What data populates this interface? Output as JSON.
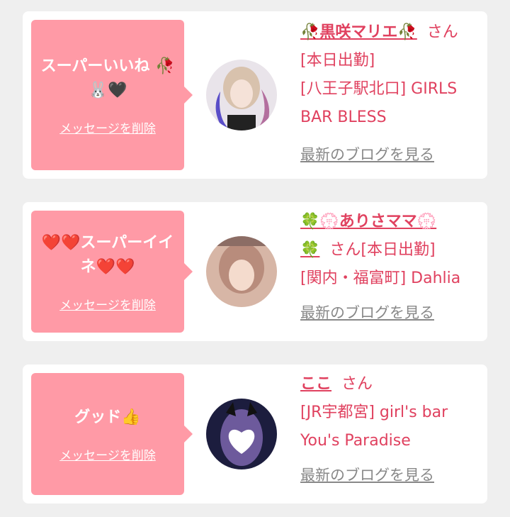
{
  "cards": [
    {
      "message": "スーパーいいね 🥀🐰🖤",
      "delete_label": "メッセージを削除",
      "name": "🥀黒咲マリエ🥀",
      "suffix": "さん[本日出勤]",
      "shop": "[八王子駅北口] GIRLS BAR BLESS",
      "blog_label": "最新のブログを見る",
      "avatar_colors": [
        "#d9c8b8",
        "#6a5ad0",
        "#f3e7df"
      ]
    },
    {
      "message": "❤️❤️スーパーイイネ❤️❤️",
      "delete_label": "メッセージを削除",
      "name": "🍀💮ありさママ💮🍀",
      "suffix": "さん[本日出勤]",
      "shop": "[関内・福富町] Dahlia",
      "blog_label": "最新のブログを見る",
      "avatar_colors": [
        "#c9a393",
        "#f2d7c8",
        "#8a6a5d"
      ]
    },
    {
      "message": "グッド👍",
      "delete_label": "メッセージを削除",
      "name": "ここ",
      "suffix": "さん",
      "shop": "[JR宇都宮] girl's bar You's Paradise",
      "blog_label": "最新のブログを見る",
      "avatar_colors": [
        "#1e2044",
        "#b89ad0",
        "#ffffff"
      ]
    }
  ]
}
